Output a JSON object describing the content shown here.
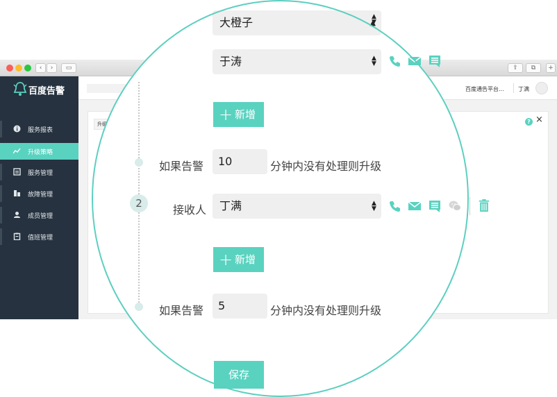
{
  "app": {
    "brand": "百度告警"
  },
  "sidebar": {
    "items": [
      {
        "label": "服务报表",
        "icon": "info-icon"
      },
      {
        "label": "升级策略",
        "icon": "trend-icon",
        "active": true
      },
      {
        "label": "服务管理",
        "icon": "service-icon"
      },
      {
        "label": "故障管理",
        "icon": "fault-icon"
      },
      {
        "label": "成员管理",
        "icon": "user-icon"
      },
      {
        "label": "值班管理",
        "icon": "clipboard-icon"
      }
    ]
  },
  "topbar": {
    "platform": "百度通告平台...",
    "user": "丁满"
  },
  "content": {
    "breadcrumb": "升级策略"
  },
  "form": {
    "select_top": "大橙子",
    "select_second": "于涛",
    "add_label": "新增",
    "rule1": {
      "prefix": "如果告警",
      "minutes": "10",
      "suffix": "分钟内没有处理则升级"
    },
    "step2": {
      "number": "2",
      "receiver_label": "接收人",
      "receiver": "丁满"
    },
    "rule2": {
      "prefix": "如果告警",
      "minutes": "5",
      "suffix": "分钟内没有处理则升级"
    },
    "save_label": "保存"
  },
  "colors": {
    "accent": "#5ad2c0",
    "sidebar": "#26323f"
  }
}
